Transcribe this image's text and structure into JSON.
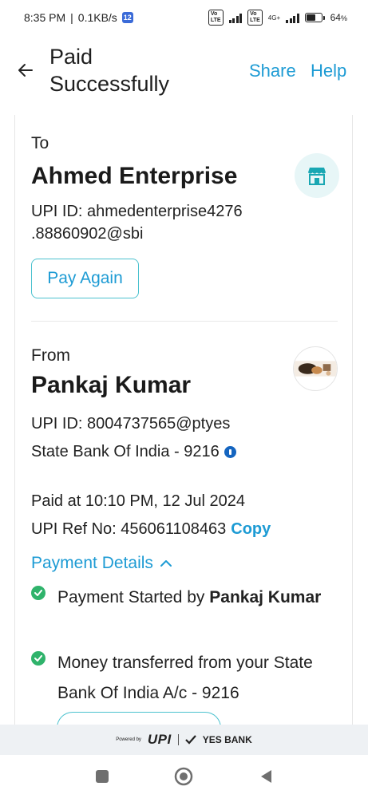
{
  "status_bar": {
    "time": "8:35 PM",
    "speed": "0.1KB/s",
    "notification_badge": "12",
    "network_1": "Vo LTE",
    "network_2": "Vo LTE",
    "network_type": "4G+",
    "battery": "64",
    "battery_suffix": "%"
  },
  "header": {
    "title": "Paid Successfully",
    "share_label": "Share",
    "help_label": "Help",
    "back_icon": "arrow-left-icon"
  },
  "recipient": {
    "label": "To",
    "name": "Ahmed Enterprise",
    "upi_line1": "UPI ID: ahmedenterprise4276",
    "upi_line2": ".88860902@sbi",
    "pay_again_label": "Pay Again",
    "avatar_icon": "store-icon"
  },
  "sender": {
    "label": "From",
    "name": "Pankaj Kumar",
    "upi": "UPI ID: 8004737565@ptyes",
    "bank": "State Bank Of India - 9216",
    "paid_at": "Paid at 10:10 PM, 12 Jul 2024",
    "ref_label": "UPI Ref No: 456061108463",
    "copy_label": "Copy"
  },
  "payment_details": {
    "toggle_label": "Payment Details",
    "steps": [
      {
        "prefix": "Payment Started by ",
        "bold": "Pankaj Kumar"
      },
      {
        "prefix": "Money transferred from your State Bank Of India A/c - 9216",
        "bold": ""
      }
    ]
  },
  "footer": {
    "powered_by": "Powered by",
    "upi": "UPI",
    "bank": "YES BANK"
  },
  "colors": {
    "accent": "#1d9bd4",
    "button_border": "#4cc2cf",
    "success": "#2fb36b",
    "info": "#1565c0"
  }
}
